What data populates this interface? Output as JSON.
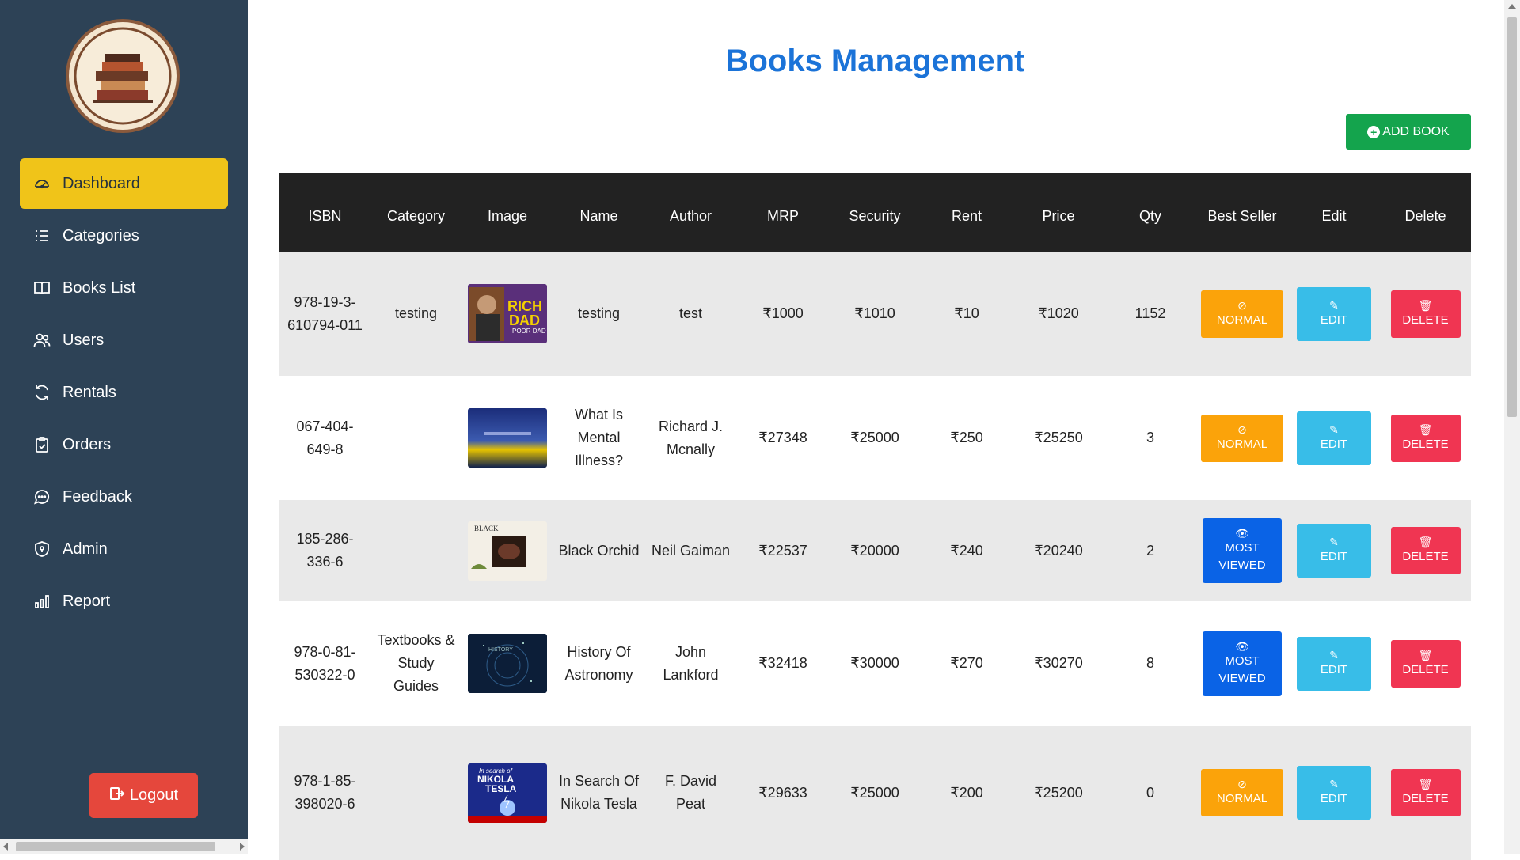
{
  "sidebar": {
    "items": [
      {
        "label": "Dashboard",
        "icon": "dashboard-icon",
        "active": true
      },
      {
        "label": "Categories",
        "icon": "list-icon",
        "active": false
      },
      {
        "label": "Books List",
        "icon": "book-icon",
        "active": false
      },
      {
        "label": "Users",
        "icon": "users-icon",
        "active": false
      },
      {
        "label": "Rentals",
        "icon": "refresh-icon",
        "active": false
      },
      {
        "label": "Orders",
        "icon": "clipboard-icon",
        "active": false
      },
      {
        "label": "Feedback",
        "icon": "chat-icon",
        "active": false
      },
      {
        "label": "Admin",
        "icon": "shield-icon",
        "active": false
      },
      {
        "label": "Report",
        "icon": "bar-chart-icon",
        "active": false
      }
    ],
    "logout_label": "Logout"
  },
  "main": {
    "title": "Books Management",
    "add_button_label": "ADD BOOK",
    "columns": [
      "ISBN",
      "Category",
      "Image",
      "Name",
      "Author",
      "MRP",
      "Security",
      "Rent",
      "Price",
      "Qty",
      "Best Seller",
      "Edit",
      "Delete"
    ],
    "rows": [
      {
        "isbn": "978-19-3-610794-011",
        "category": "testing",
        "image": "rich-dad-poor-dad-cover",
        "name": "testing",
        "author": "test",
        "mrp": "₹1000",
        "security": "₹1010",
        "rent": "₹10",
        "price": "₹1020",
        "qty": "1152",
        "status": "NORMAL",
        "edit": "EDIT",
        "delete": "DELETE"
      },
      {
        "isbn": "067-404-649-8",
        "category": "",
        "image": "mental-illness-cover",
        "name": "What Is Mental Illness?",
        "author": "Richard J. Mcnally",
        "mrp": "₹27348",
        "security": "₹25000",
        "rent": "₹250",
        "price": "₹25250",
        "qty": "3",
        "status": "NORMAL",
        "edit": "EDIT",
        "delete": "DELETE"
      },
      {
        "isbn": "185-286-336-6",
        "category": "",
        "image": "black-orchid-cover",
        "name": "Black Orchid",
        "author": "Neil Gaiman",
        "mrp": "₹22537",
        "security": "₹20000",
        "rent": "₹240",
        "price": "₹20240",
        "qty": "2",
        "status": "MOST VIEWED",
        "edit": "EDIT",
        "delete": "DELETE"
      },
      {
        "isbn": "978-0-81-530322-0",
        "category": "Textbooks & Study Guides",
        "image": "history-of-astronomy-cover",
        "name": "History Of Astronomy",
        "author": "John Lankford",
        "mrp": "₹32418",
        "security": "₹30000",
        "rent": "₹270",
        "price": "₹30270",
        "qty": "8",
        "status": "MOST VIEWED",
        "edit": "EDIT",
        "delete": "DELETE"
      },
      {
        "isbn": "978-1-85-398020-6",
        "category": "",
        "image": "nikola-tesla-cover",
        "name": "In Search Of Nikola Tesla",
        "author": "F. David Peat",
        "mrp": "₹29633",
        "security": "₹25000",
        "rent": "₹200",
        "price": "₹25200",
        "qty": "0",
        "status": "NORMAL",
        "edit": "EDIT",
        "delete": "DELETE"
      }
    ]
  },
  "colors": {
    "sidebar_bg": "#2d4256",
    "active_nav": "#f0c419",
    "title": "#1b73d8",
    "add_button": "#14a44d",
    "normal": "#fba30a",
    "most_viewed": "#0a63e6",
    "edit": "#38bde8",
    "delete": "#f03552",
    "logout": "#e5473c"
  }
}
